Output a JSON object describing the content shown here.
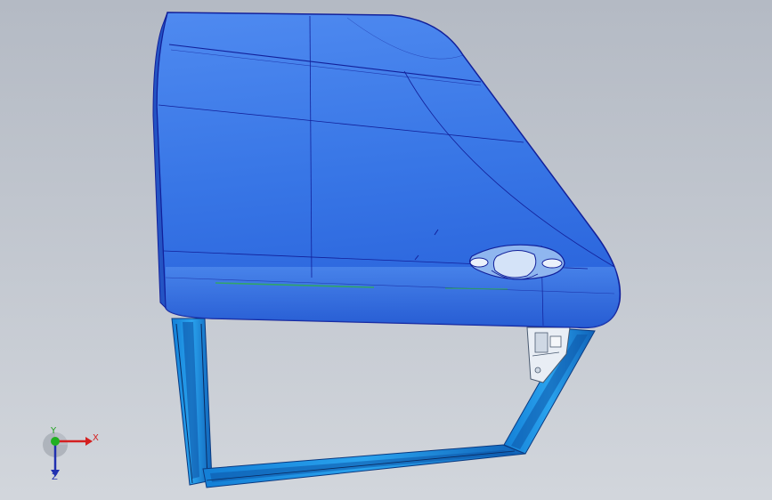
{
  "triad": {
    "x_label": "X",
    "y_label": "Y",
    "z_label": "Z"
  },
  "colors": {
    "background_top": "#b4bac4",
    "background_bottom": "#d2d6dc",
    "panel_blue": "#3b7ae6",
    "panel_edge": "#12209a",
    "frame_blue": "#1d8ee0",
    "axis_x": "#d42020",
    "axis_y": "#20a020",
    "axis_z": "#2030b0"
  }
}
